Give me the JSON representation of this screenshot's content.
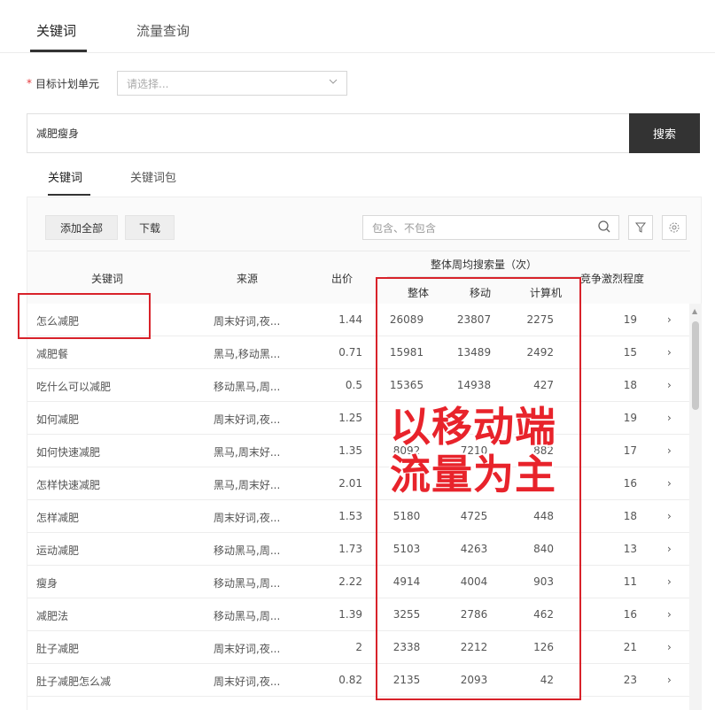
{
  "top_tabs": [
    {
      "label": "关键词",
      "active": true
    },
    {
      "label": "流量查询",
      "active": false
    }
  ],
  "unit": {
    "required_mark": "*",
    "label": "目标计划单元",
    "placeholder": "请选择..."
  },
  "search": {
    "value": "减肥瘦身",
    "button": "搜索"
  },
  "sub_tabs": [
    {
      "label": "关键词",
      "active": true
    },
    {
      "label": "关键词包",
      "active": false
    }
  ],
  "toolbar": {
    "add_all": "添加全部",
    "download": "下载",
    "filter_placeholder": "包含、不包含"
  },
  "table": {
    "headers": {
      "keyword": "关键词",
      "source": "来源",
      "price": "出价",
      "weekly_group": "整体周均搜索量（次）",
      "total": "整体",
      "mobile": "移动",
      "pc": "计算机",
      "competition": "竞争激烈程度"
    },
    "rows": [
      {
        "keyword": "怎么减肥",
        "source": "周末好词,夜...",
        "price": "1.44",
        "total": "26089",
        "mobile": "23807",
        "pc": "2275",
        "competition": "19"
      },
      {
        "keyword": "减肥餐",
        "source": "黑马,移动黑...",
        "price": "0.71",
        "total": "15981",
        "mobile": "13489",
        "pc": "2492",
        "competition": "15"
      },
      {
        "keyword": "吃什么可以减肥",
        "source": "移动黑马,周...",
        "price": "0.5",
        "total": "15365",
        "mobile": "14938",
        "pc": "427",
        "competition": "18"
      },
      {
        "keyword": "如何减肥",
        "source": "周末好词,夜...",
        "price": "1.25",
        "total": "",
        "mobile": "",
        "pc": "",
        "competition": "19"
      },
      {
        "keyword": "如何快速减肥",
        "source": "黑马,周末好...",
        "price": "1.35",
        "total": "8092",
        "mobile": "7210",
        "pc": "882",
        "competition": "17"
      },
      {
        "keyword": "怎样快速减肥",
        "source": "黑马,周末好...",
        "price": "2.01",
        "total": "",
        "mobile": "",
        "pc": "",
        "competition": "16"
      },
      {
        "keyword": "怎样减肥",
        "source": "周末好词,夜...",
        "price": "1.53",
        "total": "5180",
        "mobile": "4725",
        "pc": "448",
        "competition": "18"
      },
      {
        "keyword": "运动减肥",
        "source": "移动黑马,周...",
        "price": "1.73",
        "total": "5103",
        "mobile": "4263",
        "pc": "840",
        "competition": "13"
      },
      {
        "keyword": "瘦身",
        "source": "移动黑马,周...",
        "price": "2.22",
        "total": "4914",
        "mobile": "4004",
        "pc": "903",
        "competition": "11"
      },
      {
        "keyword": "减肥法",
        "source": "移动黑马,周...",
        "price": "1.39",
        "total": "3255",
        "mobile": "2786",
        "pc": "462",
        "competition": "16"
      },
      {
        "keyword": "肚子减肥",
        "source": "周末好词,夜...",
        "price": "2",
        "total": "2338",
        "mobile": "2212",
        "pc": "126",
        "competition": "21"
      },
      {
        "keyword": "肚子减肥怎么减",
        "source": "周末好词,夜...",
        "price": "0.82",
        "total": "2135",
        "mobile": "2093",
        "pc": "42",
        "competition": "23"
      }
    ]
  },
  "annotation": {
    "line1": "以移动端",
    "line2": "流量为主",
    "color": "#e8232b"
  },
  "colors": {
    "search_button_bg": "#333333",
    "highlight_box": "#d8222a"
  }
}
